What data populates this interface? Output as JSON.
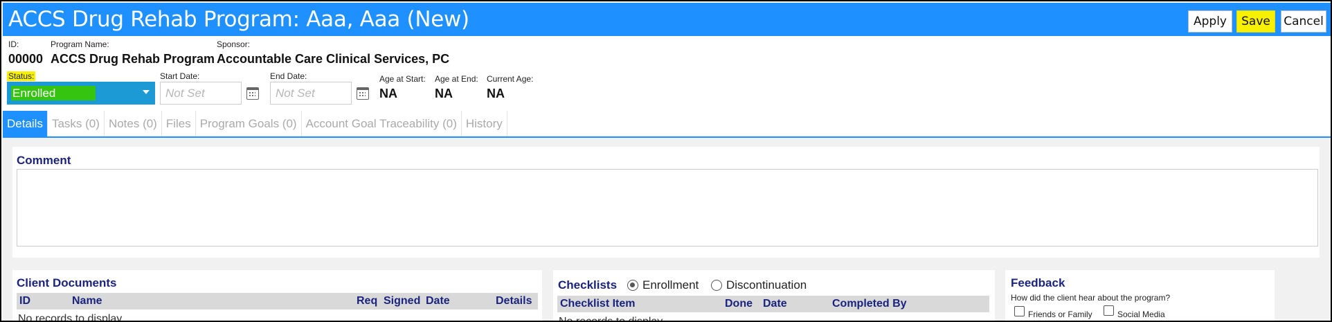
{
  "header": {
    "title": "ACCS Drug Rehab Program: Aaa, Aaa (New)",
    "buttons": {
      "apply": "Apply",
      "save": "Save",
      "cancel": "Cancel"
    }
  },
  "info": {
    "id_label": "ID:",
    "id_value": "00000",
    "program_label": "Program Name:",
    "program_value": "ACCS Drug Rehab Program",
    "sponsor_label": "Sponsor:",
    "sponsor_value": "Accountable Care Clinical Services, PC",
    "status_label": "Status:",
    "status_value": "Enrolled",
    "start_label": "Start Date:",
    "start_placeholder": "Not Set",
    "end_label": "End Date:",
    "end_placeholder": "Not Set",
    "age_start_label": "Age at Start:",
    "age_start_value": "NA",
    "age_end_label": "Age at End:",
    "age_end_value": "NA",
    "current_age_label": "Current Age:",
    "current_age_value": "NA"
  },
  "tabs": [
    {
      "label": "Details",
      "active": true
    },
    {
      "label": "Tasks (0)"
    },
    {
      "label": "Notes (0)"
    },
    {
      "label": "Files"
    },
    {
      "label": "Program Goals (0)"
    },
    {
      "label": "Account Goal Traceability (0)"
    },
    {
      "label": "History"
    }
  ],
  "comment": {
    "title": "Comment"
  },
  "client_documents": {
    "title": "Client Documents",
    "columns": [
      "ID",
      "Name",
      "Req",
      "Signed",
      "Date",
      "Details"
    ],
    "empty": "No records to display"
  },
  "checklists": {
    "title": "Checklists",
    "options": [
      "Enrollment",
      "Discontinuation"
    ],
    "selected": "Enrollment",
    "columns": [
      "Checklist Item",
      "Done",
      "Date",
      "Completed By"
    ],
    "empty": "No records to display"
  },
  "feedback": {
    "title": "Feedback",
    "question": "How did the client hear about the program?",
    "options": [
      "Friends or Family",
      "Social Media"
    ]
  },
  "colors": {
    "header_bg": "#1e90ff",
    "save_highlight": "#f7f000",
    "status_bg": "#1c9ad6",
    "status_value_bg": "#35c40f",
    "section_title": "#1a237e"
  }
}
